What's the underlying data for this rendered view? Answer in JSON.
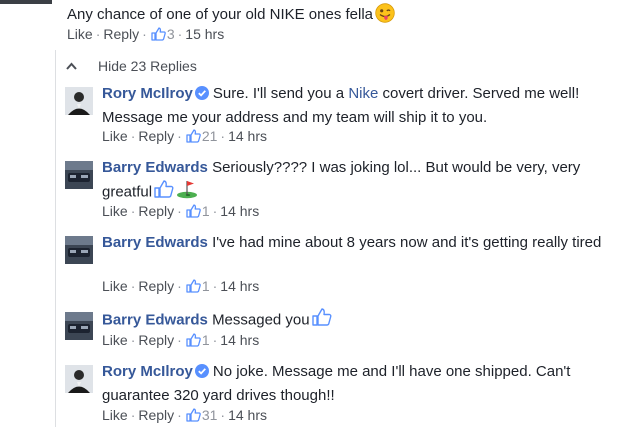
{
  "top_comment": {
    "text": "Any chance of one of your old NIKE ones fella",
    "emoji": "tongue-wink-emoji",
    "actions": {
      "like": "Like",
      "reply": "Reply",
      "likes": "3",
      "time": "15 hrs"
    }
  },
  "hide_replies": "Hide 23 Replies",
  "replies": [
    {
      "author": "Rory McIlroy",
      "verified": true,
      "text_before": "Sure. I'll send you a ",
      "link": "Nike",
      "text_after": " covert driver. Served me well! Message me your address and my team will ship it to you.",
      "actions": {
        "like": "Like",
        "reply": "Reply",
        "likes": "21",
        "time": "14 hrs"
      }
    },
    {
      "author": "Barry Edwards",
      "verified": false,
      "text": "Seriously???? I was joking lol... But would be very, very greatful",
      "emoticons": [
        "thumbs-up-icon",
        "golf-flag-icon"
      ],
      "actions": {
        "like": "Like",
        "reply": "Reply",
        "likes": "1",
        "time": "14 hrs"
      }
    },
    {
      "author": "Barry Edwards",
      "verified": false,
      "text": "I've had mine about 8 years now and it's getting really tired",
      "actions": {
        "like": "Like",
        "reply": "Reply",
        "likes": "1",
        "time": "14 hrs"
      }
    },
    {
      "author": "Barry Edwards",
      "verified": false,
      "text": "Messaged you",
      "emoticons": [
        "thumbs-up-icon"
      ],
      "actions": {
        "like": "Like",
        "reply": "Reply",
        "likes": "1",
        "time": "14 hrs"
      }
    },
    {
      "author": "Rory McIlroy",
      "verified": true,
      "text": "No joke. Message me and I'll have one shipped. Can't guarantee 320 yard drives though!!",
      "actions": {
        "like": "Like",
        "reply": "Reply",
        "likes": "31",
        "time": "14 hrs"
      }
    }
  ]
}
